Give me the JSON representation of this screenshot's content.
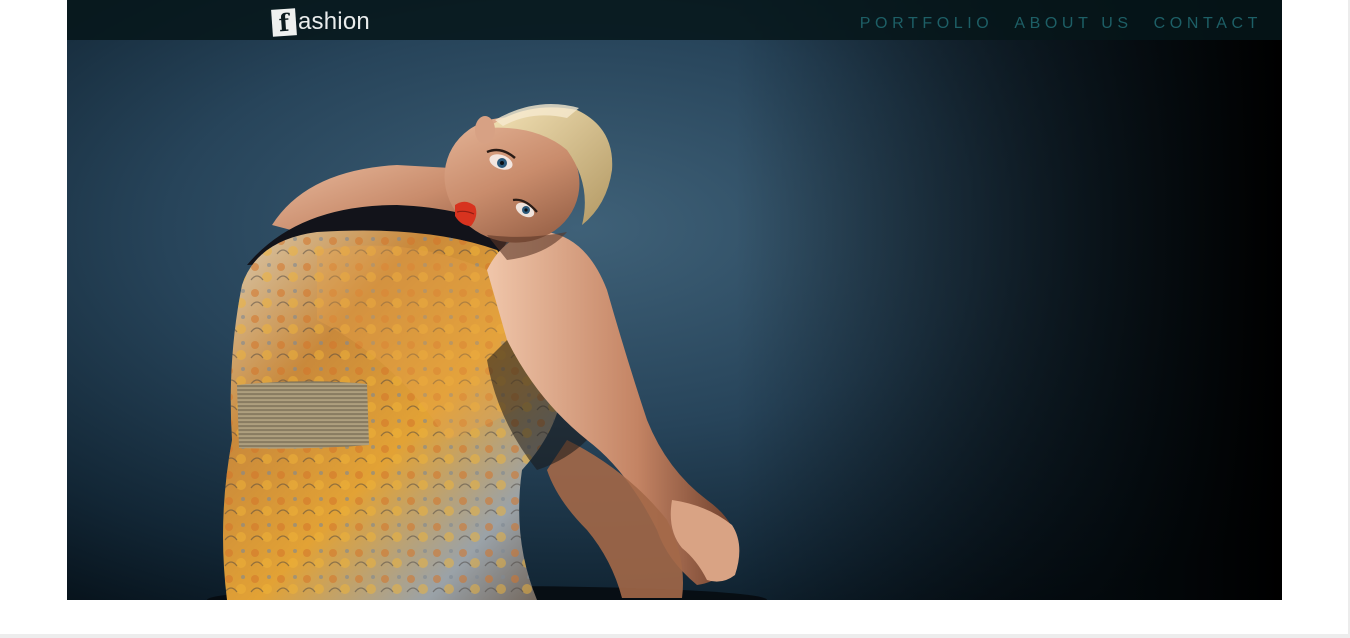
{
  "header": {
    "logo_letter": "f",
    "logo_text": "ashion",
    "nav": [
      {
        "label": "PORTFOLIO"
      },
      {
        "label": "ABOUT US"
      },
      {
        "label": "CONTACT"
      }
    ]
  },
  "hero": {
    "icon": "fashion-model-photo"
  },
  "colors": {
    "nav_text": "#1d5f66",
    "topbar_bg": "#06161a",
    "hero_bg": "#1f3a4c",
    "accent_lips": "#d7331f"
  }
}
